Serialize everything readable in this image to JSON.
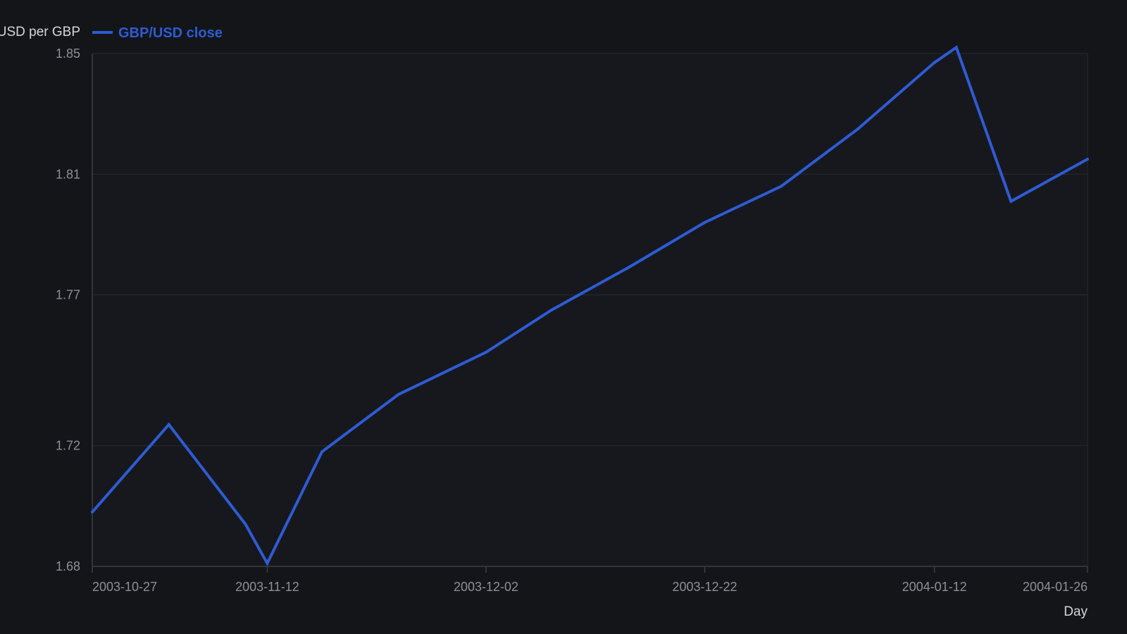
{
  "chart_data": {
    "type": "line",
    "title": "",
    "xlabel": "Day",
    "ylabel": "USD per GBP",
    "x_type": "date",
    "xlim": [
      "2003-10-27",
      "2004-01-26"
    ],
    "ylim": [
      1.68,
      1.85
    ],
    "y_ticks": [
      1.68,
      1.72,
      1.77,
      1.81,
      1.85
    ],
    "y_tick_labels": [
      "1.68",
      "1.72",
      "1.77",
      "1.81",
      "1.85"
    ],
    "x_ticks": [
      "2003-10-27",
      "2003-11-12",
      "2003-12-02",
      "2003-12-22",
      "2004-01-12",
      "2004-01-26"
    ],
    "x_tick_labels": [
      "2003-10-27",
      "2003-11-12",
      "2003-12-02",
      "2003-12-22",
      "2004-01-12",
      "2004-01-26"
    ],
    "grid": true,
    "legend_placement": "top-left",
    "series": [
      {
        "name": "GBP/USD close",
        "color": "#2f5bd3",
        "x": [
          "2003-10-27",
          "2003-11-03",
          "2003-11-10",
          "2003-11-12",
          "2003-11-17",
          "2003-11-24",
          "2003-12-02",
          "2003-12-08",
          "2003-12-15",
          "2003-12-22",
          "2003-12-29",
          "2004-01-05",
          "2004-01-12",
          "2004-01-14",
          "2004-01-19",
          "2004-01-26"
        ],
        "values": [
          1.698,
          1.727,
          1.694,
          1.681,
          1.718,
          1.737,
          1.751,
          1.765,
          1.779,
          1.794,
          1.806,
          1.825,
          1.847,
          1.852,
          1.801,
          1.815
        ]
      }
    ]
  },
  "colors": {
    "background": "#131519",
    "grid": "#262a31",
    "axis": "#3a3e45",
    "tick_text": "#8c9097",
    "title_text": "#d4d6da"
  }
}
